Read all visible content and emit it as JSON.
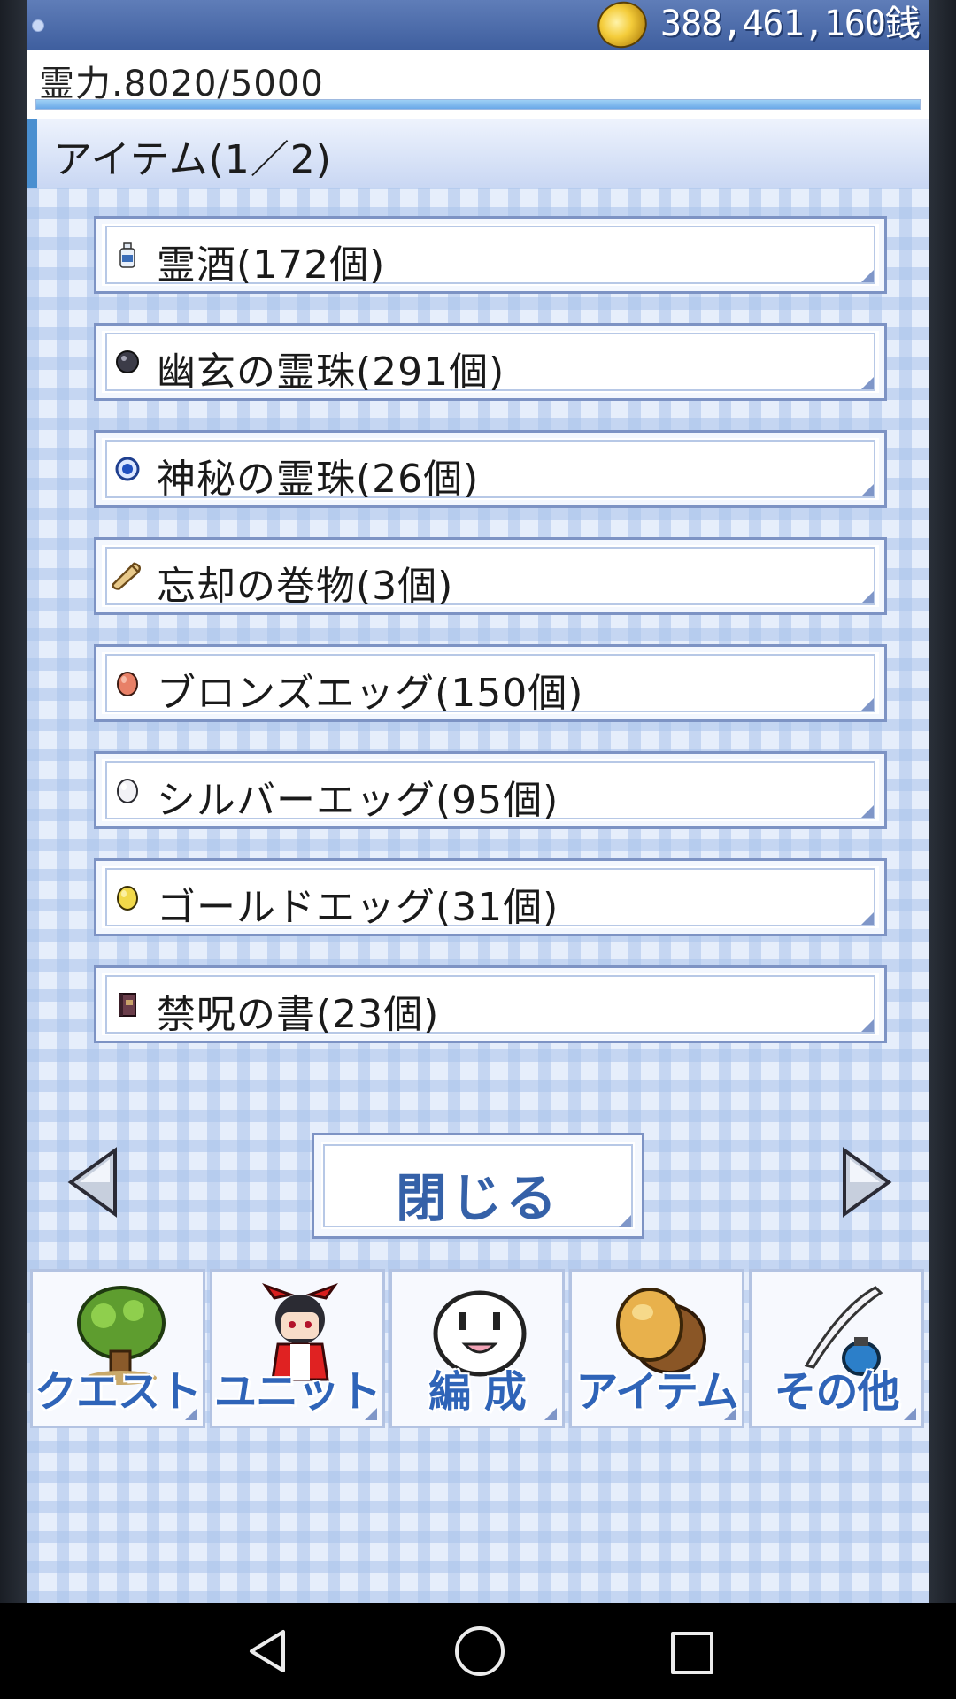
{
  "currency": {
    "amount": "388,461,160銭",
    "icon": "coin-icon"
  },
  "spirit_power": {
    "text": "霊力.8020/5000",
    "fill_percent": 100
  },
  "section": {
    "title": "アイテム(1／2)"
  },
  "items": [
    {
      "label": "霊酒(172個)",
      "icon": "sake-bottle-icon"
    },
    {
      "label": "幽玄の霊珠(291個)",
      "icon": "dark-orb-icon"
    },
    {
      "label": "神秘の霊珠(26個)",
      "icon": "blue-orb-icon"
    },
    {
      "label": "忘却の巻物(3個)",
      "icon": "scroll-icon"
    },
    {
      "label": "ブロンズエッグ(150個)",
      "icon": "bronze-egg-icon"
    },
    {
      "label": "シルバーエッグ(95個)",
      "icon": "silver-egg-icon"
    },
    {
      "label": "ゴールドエッグ(31個)",
      "icon": "gold-egg-icon"
    },
    {
      "label": "禁呪の書(23個)",
      "icon": "forbidden-book-icon"
    }
  ],
  "pager": {
    "close_label": "閉じる",
    "prev": "left-arrow-icon",
    "next": "right-arrow-icon"
  },
  "nav": [
    {
      "label": "クエスト",
      "icon": "tree-icon"
    },
    {
      "label": "ユニット",
      "icon": "shrine-maiden-icon"
    },
    {
      "label": "編 成",
      "icon": "ghost-face-icon"
    },
    {
      "label": "アイテム",
      "icon": "item-bag-icon"
    },
    {
      "label": "その他",
      "icon": "quill-ink-icon"
    }
  ],
  "system_nav": {
    "back": "back-icon",
    "home": "home-icon",
    "recent": "recent-apps-icon"
  },
  "colors": {
    "accent": "#2f64b8",
    "panel_border": "#7d93c4",
    "header_bar": "#4a8fd0"
  }
}
